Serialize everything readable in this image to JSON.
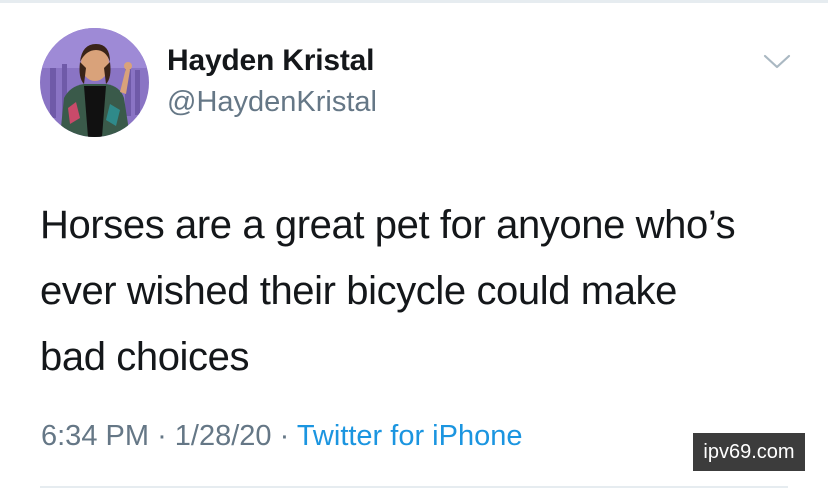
{
  "tweet": {
    "author": {
      "name": "Hayden Kristal",
      "handle": "@HaydenKristal",
      "avatar_icon": "profile-photo"
    },
    "body_lines": [
      "Horses are a great pet for anyone who’s",
      "ever wished their bicycle could make",
      "bad choices"
    ],
    "meta": {
      "time": "6:34 PM",
      "separator": "·",
      "date": "1/28/20",
      "source": "Twitter for iPhone"
    },
    "menu_icon": "chevron-down-icon"
  },
  "watermark": {
    "text": "ipv69.com"
  },
  "colors": {
    "text_primary": "#14171a",
    "text_secondary": "#657786",
    "link": "#1b95e0",
    "divider": "#e6ecf0",
    "watermark_bg": "#3c3c3c"
  }
}
